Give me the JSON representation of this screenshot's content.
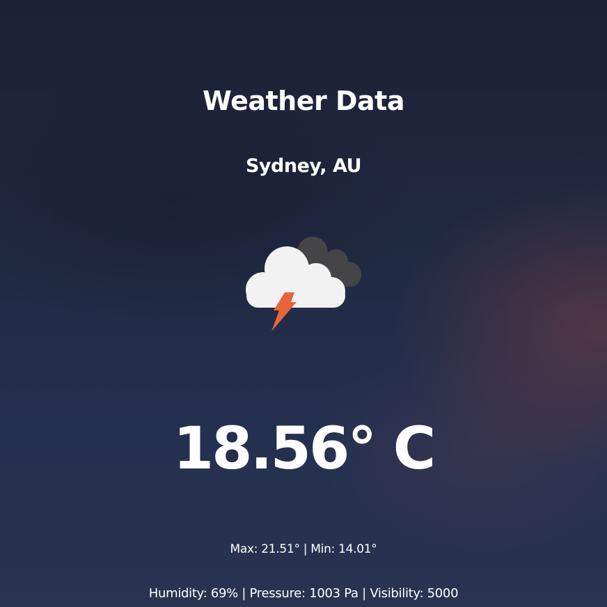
{
  "header": {
    "title": "Weather Data"
  },
  "location": {
    "label": "Sydney, AU"
  },
  "condition": {
    "icon": "thunderstorm-icon"
  },
  "temperature": {
    "current": "18.56° C"
  },
  "range": {
    "text": "Max: 21.51° | Min: 14.01°"
  },
  "details": {
    "text": "Humidity: 69% | Pressure: 1003 Pa | Visibility: 5000"
  },
  "colors": {
    "background_top": "#1c2033",
    "background_bottom": "#2a3350",
    "cloud_front": "#f2f2f2",
    "cloud_back": "#454547",
    "lightning": "#e8643a"
  }
}
